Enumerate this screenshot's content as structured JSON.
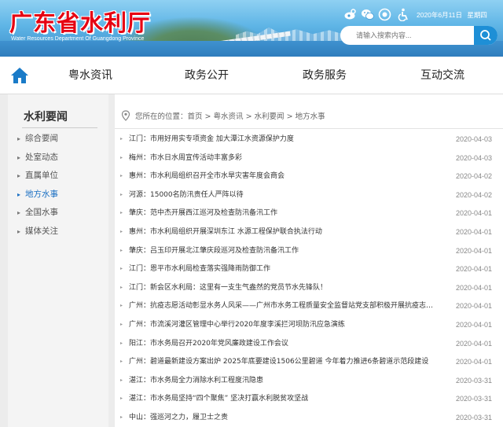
{
  "header": {
    "title": "广东省水利厅",
    "subtitle": "Water Resources Department Of Guangdong Province",
    "date": "2020年6月11日",
    "weekday": "星期四",
    "icons": [
      "weibo-icon",
      "wechat-icon",
      "sina-icon",
      "accessibility-icon"
    ],
    "search_placeholder": "请输入搜索内容..."
  },
  "nav": {
    "items": [
      "粤水资讯",
      "政务公开",
      "政务服务",
      "互动交流"
    ]
  },
  "sidebar": {
    "title": "水利要闻",
    "items": [
      {
        "label": "综合要闻",
        "active": false
      },
      {
        "label": "处室动态",
        "active": false
      },
      {
        "label": "直属单位",
        "active": false
      },
      {
        "label": "地方水事",
        "active": true
      },
      {
        "label": "全国水事",
        "active": false
      },
      {
        "label": "媒体关注",
        "active": false
      }
    ]
  },
  "breadcrumb": {
    "prefix": "您所在的位置：",
    "parts": [
      "首页",
      "粤水资讯",
      "水利要闻",
      "地方水事"
    ],
    "separator": " > "
  },
  "articles": [
    {
      "title": "江门：市用好用实专项资金 加大潭江水资源保护力度",
      "date": "2020-04-03"
    },
    {
      "title": "梅州：市水日水周宣传活动丰富多彩",
      "date": "2020-04-03"
    },
    {
      "title": "惠州：市水利局组织召开全市水旱灾害年度会商会",
      "date": "2020-04-02"
    },
    {
      "title": "河源：15000名防汛责任人严阵以待",
      "date": "2020-04-02"
    },
    {
      "title": "肇庆：范中杰开展西江巡河及检查防汛备汛工作",
      "date": "2020-04-01"
    },
    {
      "title": "惠州：市水利局组织开展深圳东江 水源工程保护联合执法行动",
      "date": "2020-04-01"
    },
    {
      "title": "肇庆：吕玉印开展北江肇庆段巡河及检查防汛备汛工作",
      "date": "2020-04-01"
    },
    {
      "title": "江门：恩平市水利局检查落实强降雨防御工作",
      "date": "2020-04-01"
    },
    {
      "title": "江门：新会区水利局：这里有一支生气盎然的党员节水先锋队！",
      "date": "2020-04-01"
    },
    {
      "title": "广州：抗疫志愿活动彰显水务人风采——广州市水务工程质量安全监督站党支部积极开展抗疫志愿活动",
      "date": "2020-04-01"
    },
    {
      "title": "广州：市流溪河灌区管理中心举行2020年度李溪拦河坝防汛应急演练",
      "date": "2020-04-01"
    },
    {
      "title": "阳江：市水务局召开2020年党风廉政建设工作会议",
      "date": "2020-04-01"
    },
    {
      "title": "广州：碧道最新建设方案出炉 2025年底要建设1506公里碧道 今年着力推进6条碧道示范段建设",
      "date": "2020-04-01"
    },
    {
      "title": "湛江：市水务局全力消除水利工程度汛隐患",
      "date": "2020-03-31"
    },
    {
      "title": "湛江：市水务局坚持“四个聚焦” 坚决打赢水利脱贫攻坚战",
      "date": "2020-03-31"
    },
    {
      "title": "中山：强巡河之力，履卫士之责",
      "date": "2020-03-31"
    }
  ]
}
